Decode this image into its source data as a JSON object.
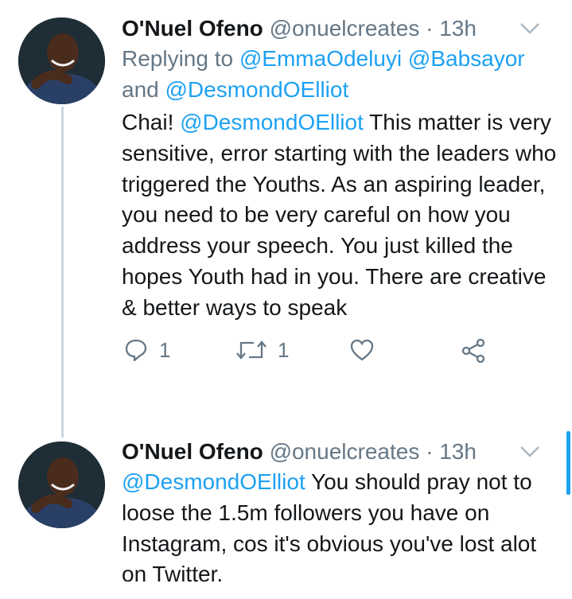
{
  "tweets": [
    {
      "name": "O'Nuel Ofeno",
      "handle": "@onuelcreates",
      "separator": "·",
      "time": "13h",
      "replying_label": "Replying to",
      "reply_mentions": [
        "@EmmaOdeluyi",
        "@Babsayor",
        "@DesmondOElliot"
      ],
      "reply_and": "and",
      "mention": "@DesmondOElliot",
      "text": "This matter is very sensitive, error starting with the leaders who triggered the Youths. As an aspiring leader, you need to be very careful on how you address your speech. You just killed the hopes Youth had in you. There are creative & better ways to speak",
      "text_prefix": "Chai!",
      "reply_count": "1",
      "retweet_count": "1",
      "icons": [
        "reply-icon",
        "retweet-icon",
        "like-icon",
        "share-icon",
        "chevron-down-icon"
      ]
    },
    {
      "name": "O'Nuel Ofeno",
      "handle": "@onuelcreates",
      "separator": "·",
      "time": "13h",
      "mention": "@DesmondOElliot",
      "text": "You should pray not to loose the 1.5m followers you have on Instagram, cos it's obvious you've lost alot on Twitter."
    }
  ],
  "colors": {
    "accent": "#1da1f2",
    "secondary_text": "#657786",
    "primary_text": "#14171a",
    "thread_line": "#ccd6dd"
  }
}
